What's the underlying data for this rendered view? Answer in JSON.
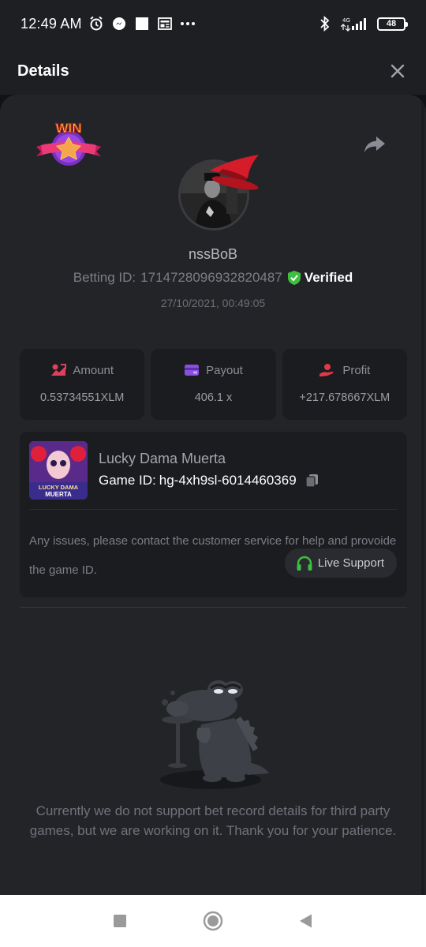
{
  "status_bar": {
    "time": "12:49 AM",
    "battery": "48",
    "network": "4G"
  },
  "header": {
    "title": "Details"
  },
  "bet": {
    "badge": "WIN",
    "username": "nssBoB",
    "betting_id_label": "Betting ID:",
    "betting_id": "1714728096932820487",
    "verified_label": "Verified",
    "timestamp": "27/10/2021, 00:49:05"
  },
  "stats": [
    {
      "label": "Amount",
      "value": "0.53734551XLM",
      "icon": "amount-icon",
      "color": "#e0405e"
    },
    {
      "label": "Payout",
      "value": "406.1 x",
      "icon": "wallet-icon",
      "color": "#8b4fe0"
    },
    {
      "label": "Profit",
      "value": "+217.678667XLM",
      "icon": "profit-icon",
      "color": "#e03a4a"
    }
  ],
  "game": {
    "name": "Lucky Dama Muerta",
    "id_label": "Game ID:",
    "id": "hg-4xh9sl-6014460369",
    "thumb_text": "LUCKY DAMA MUERTA",
    "issues_text": "Any issues, please contact the customer service for help and provoide the game ID.",
    "live_support_label": "Live Support"
  },
  "empty_state": {
    "message": "Currently we do not support bet record details for third party games, but we are working on it. Thank you for your patience."
  },
  "colors": {
    "verified": "#3fbf3f",
    "support_icon": "#3fbf3f",
    "sheet_bg": "#232428",
    "card_bg": "#1b1c1f"
  }
}
